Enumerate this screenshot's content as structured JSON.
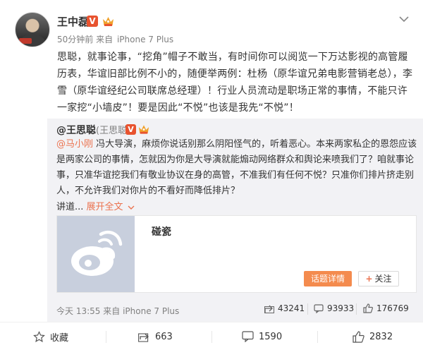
{
  "author": {
    "name": "王中磊",
    "vip_mark": "V",
    "time": "50分钟前",
    "source_prefix": "来自",
    "device": "iPhone 7 Plus"
  },
  "post_text": "思聪，就事论事，“挖角”帽子不敢当，有时间你可以阅览一下万达影视的高管履历表，华谊旧部比例不小的，随便举两例：杜杨（原华谊兄弟电影营销老总），李雪（原华谊经纪公司联席总经理）！行业人员流动是职场正常的事情，不能只许一家挖“小墙皮”！要是因此“不悦”也该是我先“不悦”！",
  "repost": {
    "user": "@王思聪",
    "alias": "(王思聪)",
    "vip_mark": "V",
    "mention": "@马小刚",
    "text": " 冯大导演，麻烦你说话别那么阴阳怪气的，听着恶心。本来两家私企的恩怨应该是两家公司的事情，怎就因为你是大导演就能煽动网络群众和舆论来喷我们了？咱就事论事，只准华谊挖我们有敬业协议在身的高管，不准我们有任何不悦？只准你们排片挤走别人，不允许我们对你片的不看好而降低排片？",
    "more_prefix": "讲道...",
    "expand_label": "展开全文",
    "card": {
      "title": "碰瓷",
      "topic_button": "话题详情",
      "follow_button": "关注"
    },
    "time": "今天 13:55",
    "source_prefix": "来自",
    "device": "iPhone 7 Plus",
    "shares": "43241",
    "comments": "93933",
    "likes": "176769"
  },
  "footer": {
    "favorite_label": "收藏",
    "shares": "663",
    "comments": "1590",
    "likes": "2832"
  },
  "colors": {
    "accent": "#eb7350",
    "vip": "#e8532f",
    "repost_bg": "#f2f2f5",
    "topic_button": "#f48b4e"
  }
}
